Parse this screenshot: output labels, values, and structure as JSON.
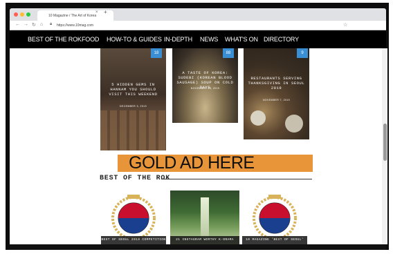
{
  "browser": {
    "tab_title": "10 Magazine / The Art of Korea",
    "tab_close": "×",
    "new_tab": "+",
    "url": "https://www.10mag.com",
    "back_icon": "arrow-left",
    "forward_icon": "arrow-right",
    "reload_icon": "reload",
    "home_icon": "home",
    "star_icon": "star"
  },
  "nav": {
    "items": [
      "BEST OF THE ROK",
      "FOOD",
      "HOW-TO & GUIDES",
      "IN-DEPTH",
      "NEWS",
      "WHAT'S ON",
      "DIRECTORY"
    ]
  },
  "cards": [
    {
      "title": "5 HIDDEN GEMS IN HANNAM YOU SHOULD VISIT THIS WEEKEND",
      "date": "DECEMBER 3, 2019",
      "badge": "18"
    },
    {
      "title": "A TASTE OF KOREA: SUDEBI (KOREAN BLOOD SAUSAGE) SOUP ON COLD DAYS",
      "date": "NOVEMBER 28, 2019",
      "badge": "88"
    },
    {
      "title": "RESTAURANTS SERVING THANKSGIVING IN SEOUL 2019",
      "date": "NOVEMBER 7, 2019",
      "badge": "9"
    }
  ],
  "ad": {
    "text": "GOLD AD HERE"
  },
  "best_of_rok": {
    "heading": "BEST OF THE ROK",
    "cards": [
      {
        "caption": "BEST OF SEOUL 2019 COMPETITION"
      },
      {
        "caption": "21 INSTAGRAM WORTHY K-DRAMA"
      },
      {
        "caption": "10 MAGAZINE 'BEST OF SEOUL'"
      }
    ]
  },
  "colors": {
    "site_nav": "#000000",
    "badge": "#3a8fd4",
    "ad": "#e8953a"
  }
}
